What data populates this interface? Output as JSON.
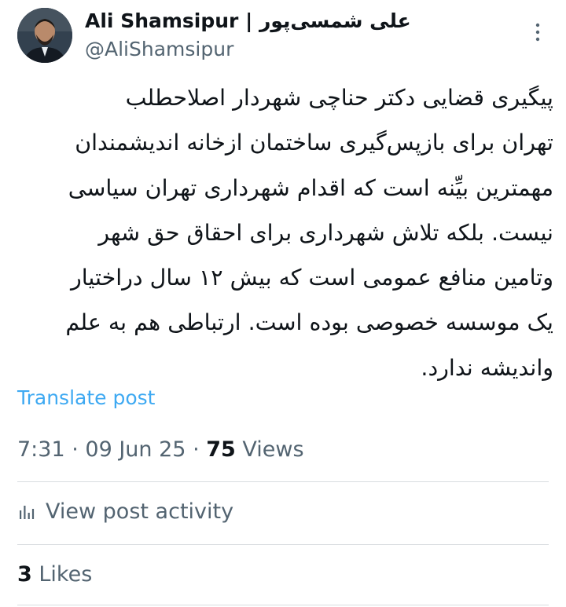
{
  "author": {
    "display_name": "Ali Shamsipur | علی شمسی‌پور",
    "handle": "@AliShamsipur",
    "avatar_icon": "profile-photo"
  },
  "post": {
    "lines": [
      "پیگیری قضایی دکتر حناچی شهردار اصلاحطلب",
      "تهران برای بازپس‌گیری ساختمان ازخانه اندیشمندان",
      "مهمترین بیِّنه است که اقدام شهرداری تهران سیاسی",
      "نیست. بلکه تلاش شهرداری برای احقاق حق شهر",
      "وتامین منافع عمومی است که بیش ۱۲ سال دراختیار",
      "یک موسسه خصوصی بوده است. ارتباطی هم به علم",
      "واندیشه ندارد."
    ],
    "translate_label": "Translate post"
  },
  "meta": {
    "time": "7:31",
    "date": "09 Jun 25",
    "views_count": "75",
    "views_label": "Views"
  },
  "activity": {
    "label": "View post activity",
    "icon": "bar-chart-icon"
  },
  "likes": {
    "count": "3",
    "label": "Likes"
  },
  "colors": {
    "text": "#0f1419",
    "secondary": "#536471",
    "link": "#1d9bf0",
    "divider": "#d9dde0"
  }
}
